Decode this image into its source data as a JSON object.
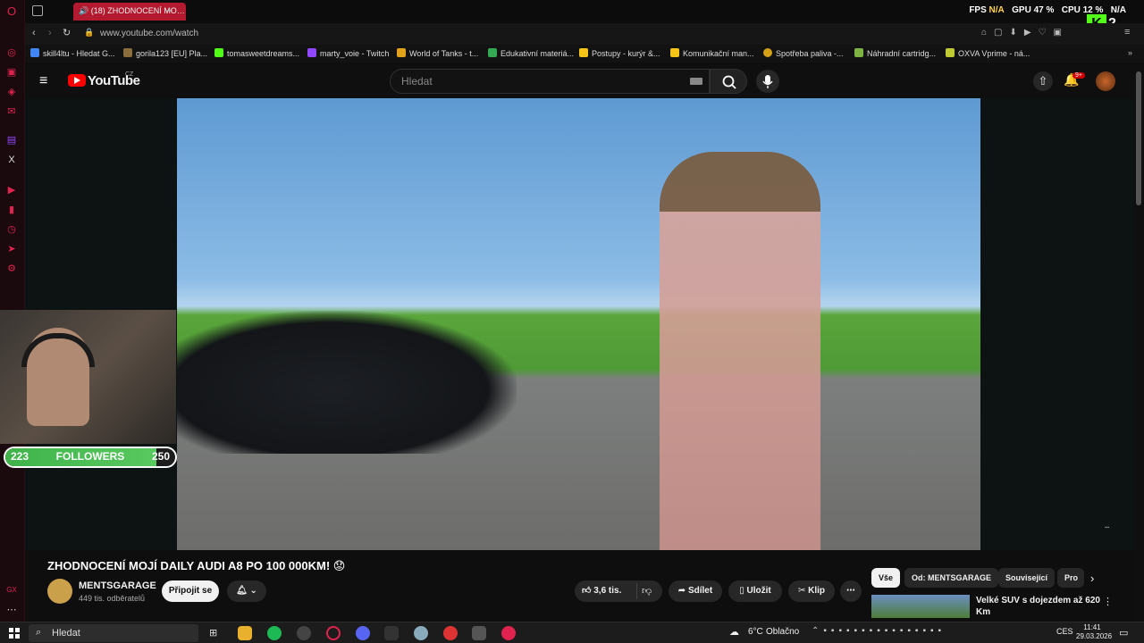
{
  "browser": {
    "tab_title": "(18) ZHODNOCENÍ MO…",
    "url": "www.youtube.com/watch",
    "stats": {
      "fps_label": "FPS",
      "fps_value": "N/A",
      "gpu_label": "GPU",
      "gpu_value": "47 %",
      "cpu_label": "CPU",
      "cpu_value": "12 %",
      "net_value": "N/A"
    },
    "kick_badge_count": "2"
  },
  "bookmarks": [
    {
      "label": "skill4ltu - Hledat G...",
      "color": "#4285f4"
    },
    {
      "label": "gorila123 [EU] Pla...",
      "color": "#8a6d3b"
    },
    {
      "label": "tomasweetdreams...",
      "color": "#53fc18"
    },
    {
      "label": "marty_voie - Twitch",
      "color": "#9146ff"
    },
    {
      "label": "World of Tanks - t...",
      "color": "#e0a11b"
    },
    {
      "label": "Edukativní materiá...",
      "color": "#34a853"
    },
    {
      "label": "Postupy - kurýr &...",
      "color": "#f5c518"
    },
    {
      "label": "Komunikační man...",
      "color": "#f5c518"
    },
    {
      "label": "Spotřeba paliva -...",
      "color": "#d4a017"
    },
    {
      "label": "Náhradní cartridg...",
      "color": "#7cb342"
    },
    {
      "label": "OXVA Vprime - ná...",
      "color": "#c0ca33"
    }
  ],
  "youtube": {
    "logo_text": "YouTube",
    "logo_region": "CZ",
    "search_placeholder": "Hledat",
    "notification_count": "9+"
  },
  "overlay": {
    "followers_label": "FOLLOWERS",
    "followers_current": "223",
    "followers_goal": "250",
    "followers_progress": 0.892
  },
  "video": {
    "title": "ZHODNOCENÍ MOJÍ DAILY AUDI A8 PO 100 000KM! 😟",
    "channel_name": "MENTSGARAGE",
    "channel_subs": "449 tis. odběratelů",
    "subscribe_label": "Připojit se",
    "likes": "3,6 tis.",
    "share_label": "Sdílet",
    "save_label": "Uložit",
    "clip_label": "Klip"
  },
  "chips": [
    "Vše",
    "Od: MENTSGARAGE",
    "Související",
    "Pro"
  ],
  "recommendation": {
    "title": "Velké SUV s dojezdem až 620 Km"
  },
  "taskbar": {
    "search_placeholder": "Hledat",
    "weather_temp": "6°C",
    "weather_text": "Oblačno",
    "language": "CES",
    "time": "11:41",
    "date": "29.03.2026"
  }
}
